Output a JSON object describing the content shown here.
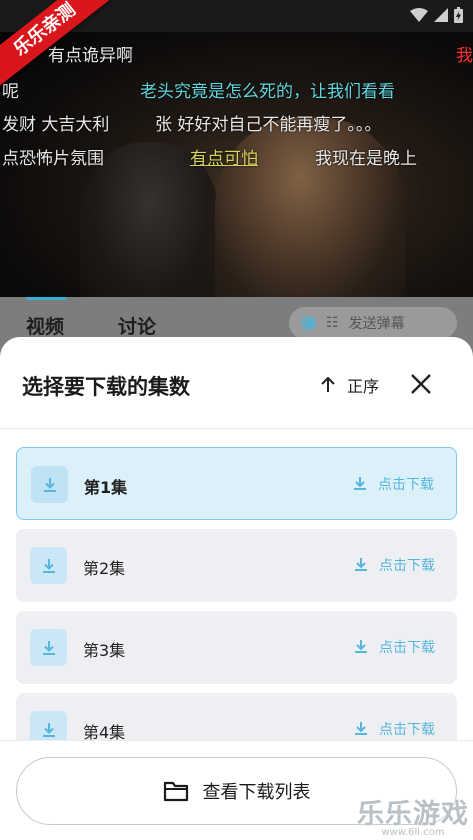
{
  "watermark": {
    "ribbon": "乐乐亲测",
    "site_name": "乐乐游戏",
    "site_url": "www.6ll.com"
  },
  "danmaku": [
    {
      "text": "有点诡异啊",
      "style": "normal"
    },
    {
      "text": "我",
      "style": "red"
    },
    {
      "text": "呢",
      "style": "normal"
    },
    {
      "text": "老头究竟是怎么死的，让我们看看",
      "style": "cyan"
    },
    {
      "text": "发财 大吉大利",
      "style": "normal"
    },
    {
      "text": "张 好好对自己不能再瘦了。。。",
      "style": "normal"
    },
    {
      "text": "点恐怖片氛围",
      "style": "normal"
    },
    {
      "text": "有点可怕",
      "style": "yellow"
    },
    {
      "text": "我现在是晚上",
      "style": "normal"
    }
  ],
  "tabs": [
    {
      "label": "视频",
      "active": true
    },
    {
      "label": "讨论",
      "active": false
    }
  ],
  "danmaku_bar": {
    "toggle_label": "弹",
    "placeholder": "发送弹幕"
  },
  "sheet": {
    "title": "选择要下载的集数",
    "sort_label": "正序",
    "episodes": [
      {
        "label": "第1集",
        "action": "点击下载",
        "selected": true
      },
      {
        "label": "第2集",
        "action": "点击下载",
        "selected": false
      },
      {
        "label": "第3集",
        "action": "点击下载",
        "selected": false
      },
      {
        "label": "第4集",
        "action": "点击下载",
        "selected": false
      }
    ],
    "footer_button": "查看下载列表"
  },
  "colors": {
    "accent": "#57b6dc",
    "selected_bg": "#dcf0fa",
    "row_bg": "#eeeff2"
  }
}
